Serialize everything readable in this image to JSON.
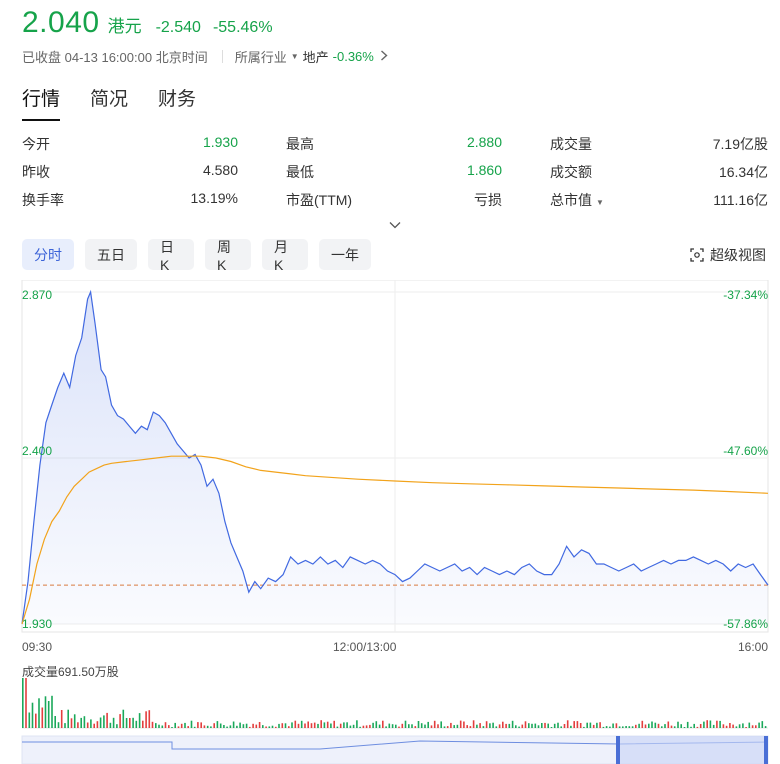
{
  "quote": {
    "price": "2.040",
    "currency": "港元",
    "change": "-2.540",
    "change_pct": "-55.46%",
    "color_down": "#16a34a"
  },
  "status": {
    "text": "已收盘 04-13 16:00:00 北京时间",
    "industry_label": "所属行业",
    "industry_name": "地产",
    "industry_pct": "-0.36%"
  },
  "tabs": [
    {
      "label": "行情",
      "active": true
    },
    {
      "label": "简况",
      "active": false
    },
    {
      "label": "财务",
      "active": false
    }
  ],
  "stats": [
    [
      {
        "label": "今开",
        "value": "1.930",
        "green": true
      },
      {
        "label": "最高",
        "value": "2.880",
        "green": true
      },
      {
        "label": "成交量",
        "value": "7.19亿股",
        "green": false
      }
    ],
    [
      {
        "label": "昨收",
        "value": "4.580",
        "green": false
      },
      {
        "label": "最低",
        "value": "1.860",
        "green": true
      },
      {
        "label": "成交额",
        "value": "16.34亿",
        "green": false
      }
    ],
    [
      {
        "label": "换手率",
        "value": "13.19%",
        "green": false
      },
      {
        "label": "市盈(TTM)",
        "value": "亏损",
        "green": false
      },
      {
        "label": "总市值",
        "value": "111.16亿",
        "green": false,
        "dropdown": true
      }
    ]
  ],
  "periods": [
    {
      "label": "分时",
      "active": true
    },
    {
      "label": "五日",
      "active": false
    },
    {
      "label": "日K",
      "active": false
    },
    {
      "label": "周K",
      "active": false
    },
    {
      "label": "月K",
      "active": false
    },
    {
      "label": "一年",
      "active": false
    }
  ],
  "super_view": "超级视图",
  "chart": {
    "y_labels_left": [
      "2.870",
      "2.400",
      "1.930"
    ],
    "y_labels_right": [
      "-37.34%",
      "-47.60%",
      "-57.86%"
    ],
    "x_labels": [
      "09:30",
      "12:00/13:00",
      "16:00"
    ],
    "volume_label": "成交量691.50万股"
  },
  "chart_data": {
    "type": "line",
    "ylim": [
      1.93,
      2.87
    ],
    "prev_close": 4.58,
    "reference_line": 2.04,
    "x_range": [
      0,
      100
    ],
    "series": [
      {
        "name": "",
        "color": "#4169e1",
        "values": [
          [
            0,
            1.93
          ],
          [
            0.8,
            2.05
          ],
          [
            1.6,
            2.22
          ],
          [
            2.4,
            2.38
          ],
          [
            3.2,
            2.5
          ],
          [
            4,
            2.55
          ],
          [
            4.8,
            2.6
          ],
          [
            5.6,
            2.64
          ],
          [
            6.4,
            2.6
          ],
          [
            7.2,
            2.69
          ],
          [
            8,
            2.74
          ],
          [
            8.8,
            2.85
          ],
          [
            9.2,
            2.87
          ],
          [
            9.8,
            2.78
          ],
          [
            10.6,
            2.65
          ],
          [
            11.2,
            2.63
          ],
          [
            12,
            2.55
          ],
          [
            12.8,
            2.52
          ],
          [
            13.6,
            2.51
          ],
          [
            14.4,
            2.49
          ],
          [
            15.2,
            2.47
          ],
          [
            16,
            2.49
          ],
          [
            16.8,
            2.48
          ],
          [
            17.6,
            2.53
          ],
          [
            18.4,
            2.52
          ],
          [
            19.2,
            2.5
          ],
          [
            20,
            2.47
          ],
          [
            20.8,
            2.44
          ],
          [
            21.6,
            2.42
          ],
          [
            22.4,
            2.4
          ],
          [
            23.2,
            2.41
          ],
          [
            24,
            2.38
          ],
          [
            24.8,
            2.32
          ],
          [
            25.6,
            2.34
          ],
          [
            26.4,
            2.3
          ],
          [
            27.2,
            2.22
          ],
          [
            28,
            2.16
          ],
          [
            28.8,
            2.12
          ],
          [
            29.6,
            2.08
          ],
          [
            30.4,
            2.02
          ],
          [
            31.2,
            2.05
          ],
          [
            32,
            2.03
          ],
          [
            33,
            2.06
          ],
          [
            34,
            2.05
          ],
          [
            35,
            2.07
          ],
          [
            36,
            2.12
          ],
          [
            37,
            2.1
          ],
          [
            38,
            2.11
          ],
          [
            39,
            2.1
          ],
          [
            40,
            2.12
          ],
          [
            41,
            2.1
          ],
          [
            42,
            2.11
          ],
          [
            43,
            2.09
          ],
          [
            44,
            2.12
          ],
          [
            45,
            2.11
          ],
          [
            46,
            2.1
          ],
          [
            47,
            2.11
          ],
          [
            48,
            2.1
          ],
          [
            49,
            2.08
          ],
          [
            50,
            2.07
          ],
          [
            51,
            2.05
          ],
          [
            52,
            2.06
          ],
          [
            53,
            2.08
          ],
          [
            54,
            2.1
          ],
          [
            55,
            2.09
          ],
          [
            56,
            2.08
          ],
          [
            57,
            2.09
          ],
          [
            58,
            2.1
          ],
          [
            59,
            2.08
          ],
          [
            60,
            2.09
          ],
          [
            61,
            2.07
          ],
          [
            62,
            2.09
          ],
          [
            63,
            2.08
          ],
          [
            64,
            2.07
          ],
          [
            65,
            2.08
          ],
          [
            66,
            2.07
          ],
          [
            67,
            2.09
          ],
          [
            68,
            2.1
          ],
          [
            69,
            2.08
          ],
          [
            70,
            2.07
          ],
          [
            71,
            2.07
          ],
          [
            72,
            2.1
          ],
          [
            73,
            2.15
          ],
          [
            74,
            2.12
          ],
          [
            75,
            2.14
          ],
          [
            76,
            2.13
          ],
          [
            77,
            2.1
          ],
          [
            78,
            2.1
          ],
          [
            79,
            2.09
          ],
          [
            80,
            2.08
          ],
          [
            81,
            2.09
          ],
          [
            82,
            2.1
          ],
          [
            83,
            2.08
          ],
          [
            84,
            2.09
          ],
          [
            85,
            2.1
          ],
          [
            86,
            2.11
          ],
          [
            87,
            2.1
          ],
          [
            88,
            2.11
          ],
          [
            89,
            2.11
          ],
          [
            90,
            2.12
          ],
          [
            91,
            2.11
          ],
          [
            92,
            2.1
          ],
          [
            93,
            2.11
          ],
          [
            94,
            2.1
          ],
          [
            95,
            2.08
          ],
          [
            96,
            2.1
          ],
          [
            97,
            2.09
          ],
          [
            98,
            2.1
          ],
          [
            99,
            2.07
          ],
          [
            100,
            2.04
          ]
        ]
      },
      {
        "name": "",
        "color": "#f2a31b",
        "values": [
          [
            0,
            1.93
          ],
          [
            1,
            2.0
          ],
          [
            2,
            2.1
          ],
          [
            3,
            2.17
          ],
          [
            4,
            2.22
          ],
          [
            5,
            2.25
          ],
          [
            6,
            2.29
          ],
          [
            7,
            2.32
          ],
          [
            8,
            2.34
          ],
          [
            9,
            2.36
          ],
          [
            10,
            2.37
          ],
          [
            11,
            2.38
          ],
          [
            12,
            2.385
          ],
          [
            14,
            2.39
          ],
          [
            16,
            2.395
          ],
          [
            18,
            2.4
          ],
          [
            20,
            2.405
          ],
          [
            22,
            2.405
          ],
          [
            24,
            2.405
          ],
          [
            26,
            2.4
          ],
          [
            28,
            2.39
          ],
          [
            30,
            2.375
          ],
          [
            32,
            2.365
          ],
          [
            34,
            2.36
          ],
          [
            36,
            2.355
          ],
          [
            38,
            2.35
          ],
          [
            40,
            2.347
          ],
          [
            45,
            2.34
          ],
          [
            50,
            2.335
          ],
          [
            55,
            2.33
          ],
          [
            60,
            2.327
          ],
          [
            65,
            2.324
          ],
          [
            70,
            2.321
          ],
          [
            75,
            2.318
          ],
          [
            80,
            2.315
          ],
          [
            85,
            2.312
          ],
          [
            90,
            2.309
          ],
          [
            95,
            2.305
          ],
          [
            100,
            2.3
          ]
        ]
      }
    ]
  }
}
